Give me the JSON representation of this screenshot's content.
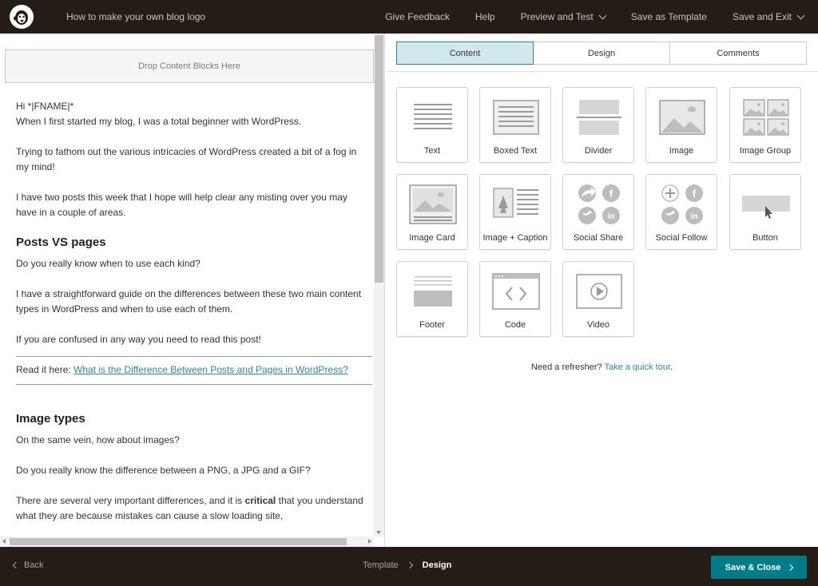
{
  "topbar": {
    "doc_title": "How to make your own blog logo",
    "actions": [
      {
        "label": "Give Feedback"
      },
      {
        "label": "Help"
      },
      {
        "label": "Preview and Test"
      },
      {
        "label": "Save as Template"
      },
      {
        "label": "Save and Exit"
      }
    ]
  },
  "editor": {
    "dropzone": "Drop Content Blocks Here",
    "greeting": "Hi *|FNAME|*",
    "p1": "When I first started my blog, I was a total beginner with WordPress.",
    "p2": "Trying to fathom out the various intricacies of WordPress created a bit of a fog in my mind!",
    "p3": "I have two posts this week that I hope will help clear any misting over you may have in a couple of areas.",
    "h1": "Posts VS pages",
    "p4": "Do you really know when to use each kind?",
    "p5": "I have a straightforward guide on the differences between these two main content types in WordPress and when to use each of them.",
    "p6": "If you are confused in any way you need to read this post!",
    "read_prefix": "Read it here: ",
    "read_link": "What is the Difference Between Posts and Pages in WordPress?",
    "h2": "Image types",
    "p7": "On the same vein, how about images?",
    "p8": "Do you really know the difference between a PNG, a JPG and a GIF?",
    "p9_a": "There are several very important differences, and it is ",
    "p9_bold": "critical",
    "p9_b": " that you understand what they are because mistakes can cause a slow loading site,"
  },
  "panel": {
    "tabs": [
      {
        "label": "Content"
      },
      {
        "label": "Design"
      },
      {
        "label": "Comments"
      }
    ],
    "blocks": [
      {
        "label": "Text",
        "icon": "text-block-icon"
      },
      {
        "label": "Boxed Text",
        "icon": "boxed-text-block-icon"
      },
      {
        "label": "Divider",
        "icon": "divider-block-icon"
      },
      {
        "label": "Image",
        "icon": "image-block-icon"
      },
      {
        "label": "Image Group",
        "icon": "image-group-block-icon"
      },
      {
        "label": "Image Card",
        "icon": "image-card-block-icon"
      },
      {
        "label": "Image + Caption",
        "icon": "image-caption-block-icon"
      },
      {
        "label": "Social Share",
        "icon": "social-share-block-icon"
      },
      {
        "label": "Social Follow",
        "icon": "social-follow-block-icon"
      },
      {
        "label": "Button",
        "icon": "button-block-icon"
      },
      {
        "label": "Footer",
        "icon": "footer-block-icon"
      },
      {
        "label": "Code",
        "icon": "code-block-icon"
      },
      {
        "label": "Video",
        "icon": "video-block-icon"
      }
    ],
    "refresher_text": "Need a refresher? ",
    "refresher_link": "Take a quick tour",
    "refresher_end": "."
  },
  "bottombar": {
    "back": "Back",
    "crumb_template": "Template",
    "crumb_current": "Design",
    "save_close": "Save & Close"
  },
  "colors": {
    "bar_bg": "#241c15",
    "accent": "#007c89",
    "active_tab": "#d1e8ec",
    "link": "#2a8a9a"
  }
}
